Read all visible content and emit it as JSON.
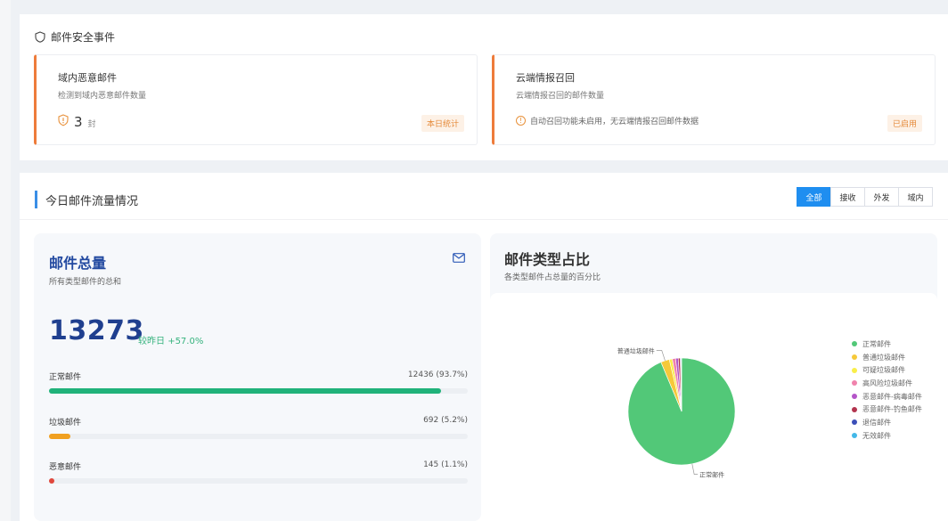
{
  "security": {
    "title": "邮件安全事件",
    "domain_card": {
      "title": "域内恶意邮件",
      "desc": "检测到域内恶意邮件数量",
      "count": "3",
      "unit": "封",
      "badge": "本日统计"
    },
    "cloud_card": {
      "title": "云端情报召回",
      "desc": "云端情报召回的邮件数量",
      "note": "自动召回功能未启用，无云端情报召回邮件数据",
      "badge": "已启用"
    }
  },
  "traffic": {
    "title": "今日邮件流量情况",
    "tabs": [
      "全部",
      "接收",
      "外发",
      "域内"
    ],
    "active_tab": 0
  },
  "total": {
    "title": "邮件总量",
    "subtitle": "所有类型邮件的总和",
    "count": "13273",
    "compare_label": "较昨日",
    "compare_value": "+57.0%",
    "bars": [
      {
        "label": "正常邮件",
        "value_text": "12436 (93.7%)",
        "fraction": 0.937,
        "color": "#20b27a"
      },
      {
        "label": "垃圾邮件",
        "value_text": "692 (5.2%)",
        "fraction": 0.052,
        "color": "#f0a020"
      },
      {
        "label": "恶意邮件",
        "value_text": "145 (1.1%)",
        "fraction": 0.011,
        "color": "#e0473c"
      }
    ]
  },
  "types": {
    "title": "邮件类型占比",
    "subtitle": "各类型邮件占总量的百分比"
  },
  "chart_data": {
    "type": "pie",
    "series": [
      {
        "name": "正常邮件",
        "value": 93.7,
        "color": "#52c878",
        "label": "正常邮件"
      },
      {
        "name": "普通垃圾邮件",
        "value": 2.6,
        "color": "#f6c93a",
        "label": "普通垃圾邮件"
      },
      {
        "name": "可疑垃圾邮件",
        "value": 0.9,
        "color": "#f9ee4a"
      },
      {
        "name": "高风险垃圾邮件",
        "value": 1.0,
        "color": "#f082ac"
      },
      {
        "name": "恶意邮件-病毒邮件",
        "value": 0.8,
        "color": "#b455c8"
      },
      {
        "name": "恶意邮件-钓鱼邮件",
        "value": 0.6,
        "color": "#b2344e"
      },
      {
        "name": "退信邮件",
        "value": 0.2,
        "color": "#3b4fb8"
      },
      {
        "name": "无效邮件",
        "value": 0.2,
        "color": "#43b8e8"
      }
    ],
    "legend_position": "right"
  }
}
